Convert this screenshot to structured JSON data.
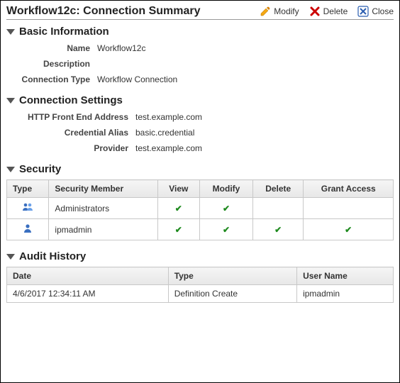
{
  "header": {
    "title": "Workflow12c: Connection Summary",
    "modify": "Modify",
    "delete": "Delete",
    "close": "Close"
  },
  "basic": {
    "heading": "Basic Information",
    "name_label": "Name",
    "name_value": "Workflow12c",
    "desc_label": "Description",
    "desc_value": "",
    "ctype_label": "Connection Type",
    "ctype_value": "Workflow Connection"
  },
  "conn": {
    "heading": "Connection Settings",
    "http_label": "HTTP Front End Address",
    "http_value": "test.example.com",
    "cred_label": "Credential Alias",
    "cred_value": "basic.credential",
    "prov_label": "Provider",
    "prov_value": "test.example.com"
  },
  "security": {
    "heading": "Security",
    "cols": {
      "type": "Type",
      "member": "Security Member",
      "view": "View",
      "modify": "Modify",
      "delete": "Delete",
      "grant": "Grant Access"
    },
    "rows": [
      {
        "icon": "group",
        "member": "Administrators",
        "view": true,
        "modify": true,
        "delete": false,
        "grant": false
      },
      {
        "icon": "user",
        "member": "ipmadmin",
        "view": true,
        "modify": true,
        "delete": true,
        "grant": true
      }
    ]
  },
  "audit": {
    "heading": "Audit History",
    "cols": {
      "date": "Date",
      "type": "Type",
      "user": "User Name"
    },
    "rows": [
      {
        "date": "4/6/2017 12:34:11 AM",
        "type": "Definition Create",
        "user": "ipmadmin"
      }
    ]
  }
}
